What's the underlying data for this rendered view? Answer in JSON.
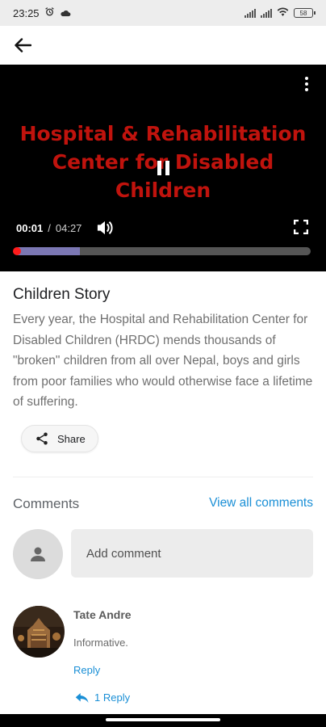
{
  "status_bar": {
    "time": "23:25",
    "battery": "58"
  },
  "video": {
    "overlay_title": "Hospital & Rehabilitation Center for Disabled Children",
    "current_time": "00:01",
    "separator": "/",
    "duration": "04:27",
    "progress_fraction": 0.0,
    "buffered_fraction": 0.22,
    "colors": {
      "title": "#c0130d",
      "progress_knob": "#ff1b1b",
      "buffer": "#7b77b3"
    }
  },
  "story": {
    "title": "Children Story",
    "description": "Every year, the Hospital and Rehabilitation Center for Disabled Children (HRDC) mends thousands of \"broken\" children from all over Nepal, boys and girls from poor families who would otherwise face a lifetime of suffering.",
    "share_label": "Share"
  },
  "comments": {
    "title": "Comments",
    "view_all_label": "View all comments",
    "add_placeholder": "Add comment",
    "items": [
      {
        "author": "Tate Andre",
        "text": "Informative.",
        "reply_label": "Reply",
        "replies_label": "1 Reply"
      }
    ]
  },
  "icons": {
    "back": "arrow-left-icon",
    "menu": "more-vert-icon",
    "pause": "pause-icon",
    "volume": "volume-icon",
    "fullscreen": "fullscreen-icon",
    "share": "share-icon",
    "avatar_placeholder": "person-icon",
    "replies": "reply-arrow-icon"
  },
  "accent_color": "#1a8fd6"
}
